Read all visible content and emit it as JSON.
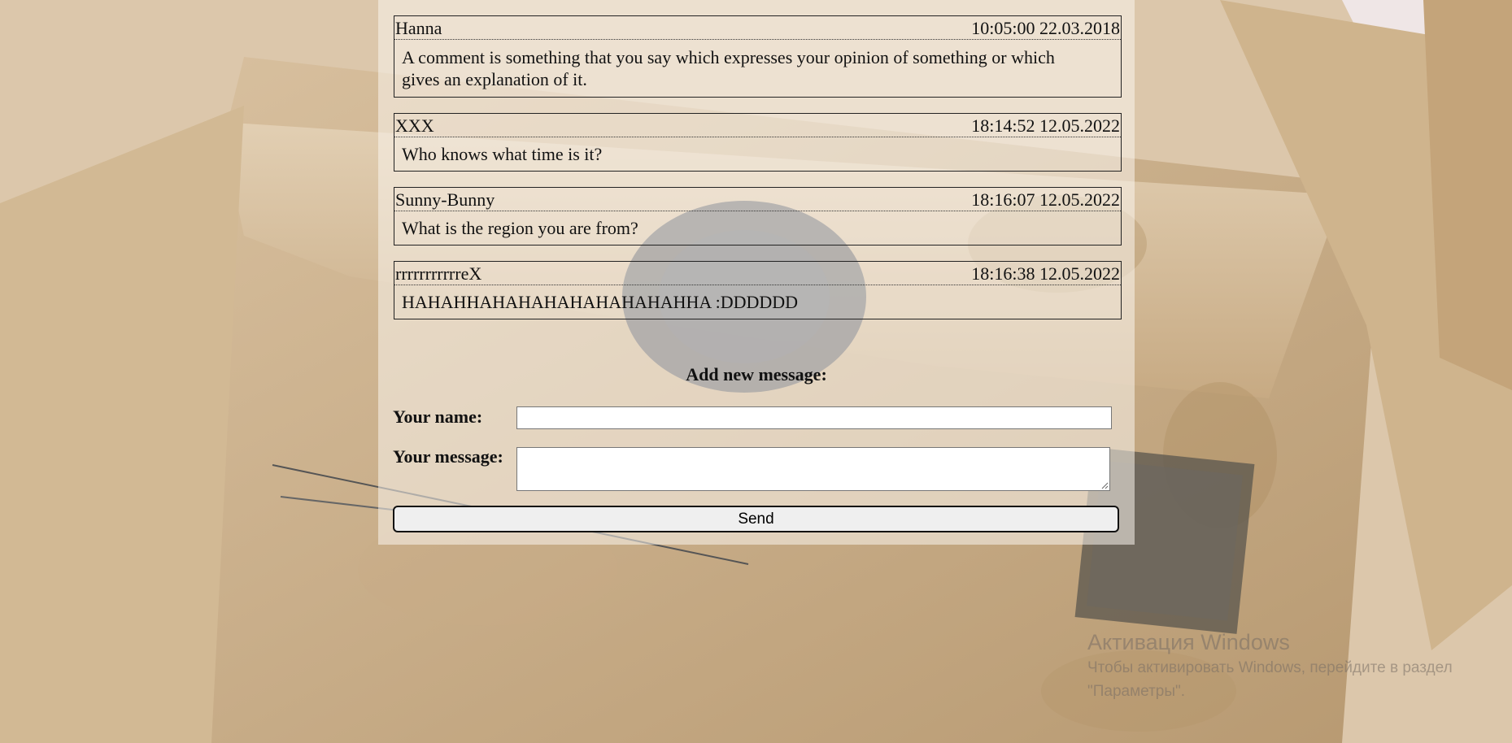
{
  "messages": [
    {
      "author": "Hanna",
      "timestamp": "10:05:00 22.03.2018",
      "text": "A comment is something that you say which expresses your opinion of something or which gives an explanation of it."
    },
    {
      "author": "XXX",
      "timestamp": "18:14:52 12.05.2022",
      "text": "Who knows what time is it?"
    },
    {
      "author": "Sunny-Bunny",
      "timestamp": "18:16:07 12.05.2022",
      "text": "What is the region you are from?"
    },
    {
      "author": "rrrrrrrrrrreX",
      "timestamp": "18:16:38 12.05.2022",
      "text": "HAHAHHAHAHAHAHAHAHAHAHHA :DDDDDD"
    }
  ],
  "form": {
    "title": "Add new message:",
    "name_label": "Your name:",
    "name_value": "",
    "message_label": "Your message:",
    "message_value": "",
    "send_label": "Send"
  },
  "watermark": {
    "title": "Активация Windows",
    "text": "Чтобы активировать Windows, перейдите в раздел \"Параметры\"."
  },
  "colors": {
    "panel": "#faf4ec",
    "border": "#222222",
    "background": "#d4b994"
  }
}
